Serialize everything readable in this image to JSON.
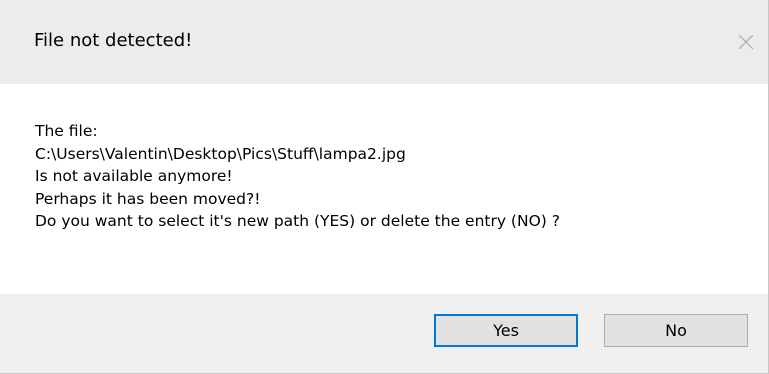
{
  "window": {
    "title": "File not detected!",
    "close_icon": "close-icon"
  },
  "message": {
    "lines": [
      "The file:",
      "C:\\Users\\Valentin\\Desktop\\Pics\\Stuff\\lampa2.jpg",
      "Is not available anymore!",
      "Perhaps it has been moved?!",
      "Do you want to select it's new path (YES) or delete the entry (NO) ?"
    ]
  },
  "buttons": {
    "yes_label": "Yes",
    "no_label": "No"
  },
  "colors": {
    "titlebar": "#ececec",
    "footer": "#f0f0f0",
    "default_button_border": "#0078d7",
    "button_face": "#e1e1e1"
  }
}
